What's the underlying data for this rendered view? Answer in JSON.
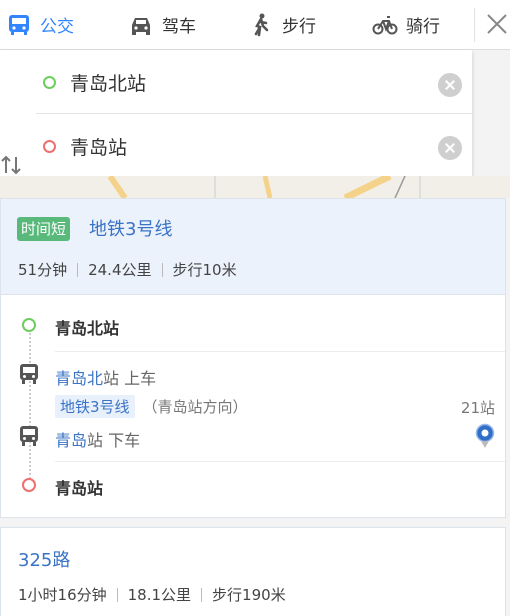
{
  "modes": [
    {
      "label": "公交",
      "icon": "bus-icon",
      "active": true
    },
    {
      "label": "驾车",
      "icon": "car-icon",
      "active": false
    },
    {
      "label": "步行",
      "icon": "walk-icon",
      "active": false
    },
    {
      "label": "骑行",
      "icon": "bike-icon",
      "active": false
    }
  ],
  "search": {
    "start": "青岛北站",
    "end": "青岛站"
  },
  "routes": [
    {
      "badge": "时间短",
      "title": "地铁3号线",
      "duration": "51分钟",
      "distance": "24.4公里",
      "walk": "步行10米",
      "steps": {
        "start": "青岛北站",
        "board_station": "青岛北",
        "board_suffix": "站",
        "board_action": "上车",
        "line": "地铁3号线",
        "direction": "（青岛站方向）",
        "stops": "21站",
        "alight_station": "青岛",
        "alight_suffix": "站",
        "alight_action": "下车",
        "end": "青岛站"
      }
    },
    {
      "title": "325路",
      "duration": "1小时16分钟",
      "distance": "18.1公里",
      "walk": "步行190米"
    }
  ],
  "colors": {
    "accent": "#3385ff",
    "link": "#3a73c5",
    "badge_green": "#58b97b",
    "start_dot": "#6dce5d",
    "end_dot": "#f06e6e"
  }
}
